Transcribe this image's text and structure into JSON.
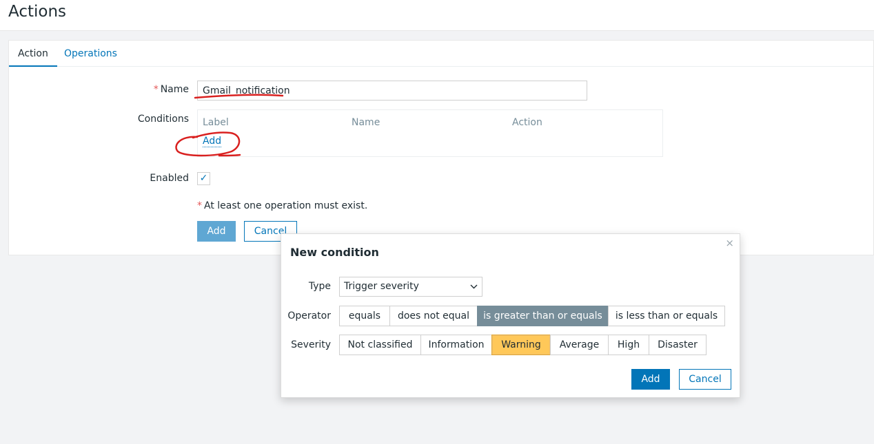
{
  "page": {
    "title": "Actions"
  },
  "tabs": [
    {
      "label": "Action"
    },
    {
      "label": "Operations"
    }
  ],
  "form": {
    "required_mark": "*",
    "name_label": "Name",
    "name_value": "Gmail_notification",
    "conditions_label": "Conditions",
    "conditions_headers": [
      "Label",
      "Name",
      "Action"
    ],
    "conditions_add": "Add",
    "enabled_label": "Enabled",
    "enabled_checked": true,
    "operation_note": "At least one operation must exist.",
    "add_button": "Add",
    "cancel_button": "Cancel"
  },
  "dialog": {
    "title": "New condition",
    "close_icon": "×",
    "type_label": "Type",
    "type_value": "Trigger severity",
    "operator_label": "Operator",
    "operators": [
      "equals",
      "does not equal",
      "is greater than or equals",
      "is less than or equals"
    ],
    "operator_selected": "is greater than or equals",
    "severity_label": "Severity",
    "severities": [
      "Not classified",
      "Information",
      "Warning",
      "Average",
      "High",
      "Disaster"
    ],
    "severity_selected": "Warning",
    "add_button": "Add",
    "cancel_button": "Cancel"
  },
  "colors": {
    "primary": "#0275b8",
    "operator_active": "#768d99",
    "severity_warning": "#ffc859",
    "required": "#e45959",
    "annotation": "#d9201f"
  }
}
